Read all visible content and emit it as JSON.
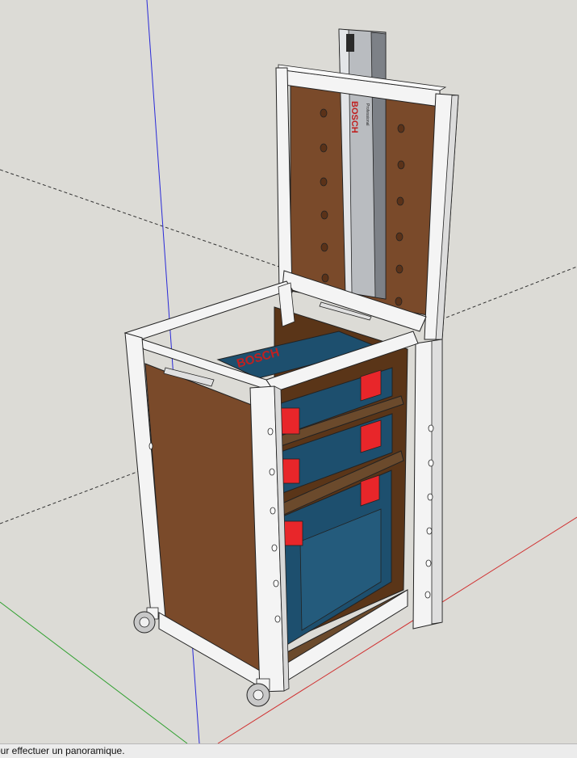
{
  "viewport": {
    "label": "3D model view",
    "background_color": "#dcdbd6",
    "axes": {
      "blue_axis_color": "#2a2ad8",
      "red_axis_color": "#d03030",
      "green_axis_color": "#30a030",
      "inference_line_color": "#333333"
    },
    "model": {
      "wood_color": "#7a4a2a",
      "frame_color": "#f4f4f4",
      "case_color": "#1d4f6e",
      "latch_color": "#e8262a",
      "shelf_color": "#6b4a2c",
      "brand_text_case": "BOSCH",
      "rail_brand_text": "BOSCH",
      "rail_subtext": "Professional"
    }
  },
  "status_bar": {
    "text": "our effectuer un panoramique."
  }
}
